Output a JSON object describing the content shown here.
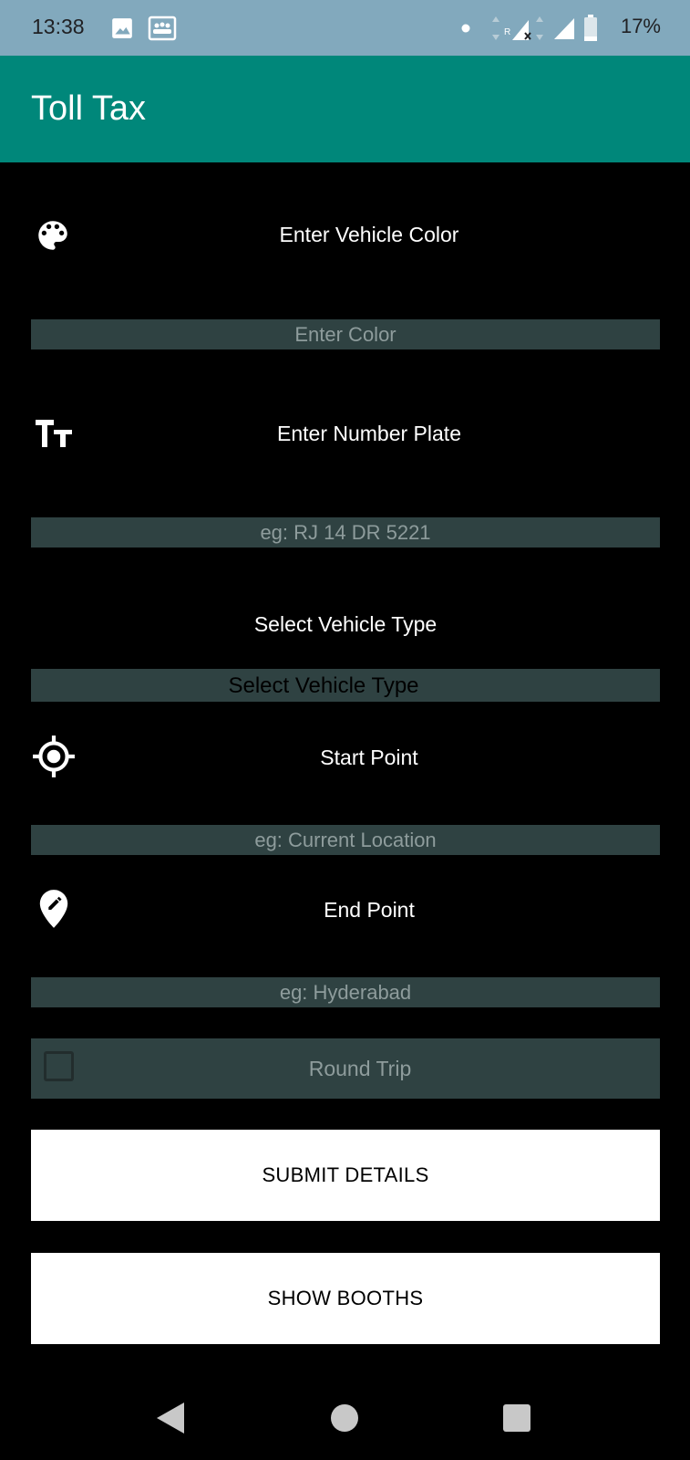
{
  "status_bar": {
    "time": "13:38",
    "battery": "17%",
    "icons": [
      "image-icon",
      "screenshot-icon",
      "dot-icon",
      "signal-roaming-icon",
      "signal-icon",
      "battery-icon"
    ]
  },
  "app_bar": {
    "title": "Toll Tax"
  },
  "form": {
    "color": {
      "label": "Enter Vehicle Color",
      "placeholder": "Enter Color",
      "icon": "palette-icon"
    },
    "plate": {
      "label": "Enter Number Plate",
      "placeholder": "eg: RJ 14 DR 5221",
      "icon": "text-size-icon"
    },
    "type": {
      "label": "Select Vehicle Type",
      "selected": "Select Vehicle Type"
    },
    "start": {
      "label": "Start Point",
      "placeholder": "eg: Current Location",
      "icon": "gps-target-icon"
    },
    "end": {
      "label": "End Point",
      "placeholder": "eg: Hyderabad",
      "icon": "edit-location-icon"
    },
    "round_trip": {
      "label": "Round Trip",
      "checked": false
    }
  },
  "buttons": {
    "submit": "SUBMIT DETAILS",
    "booths": "SHOW BOOTHS"
  },
  "nav": {
    "icons": [
      "back-icon",
      "home-icon",
      "recents-icon"
    ]
  },
  "colors": {
    "status_bar": "#82a9bd",
    "app_bar": "#00877a",
    "field_bg": "#2f4242",
    "background": "#000000"
  }
}
